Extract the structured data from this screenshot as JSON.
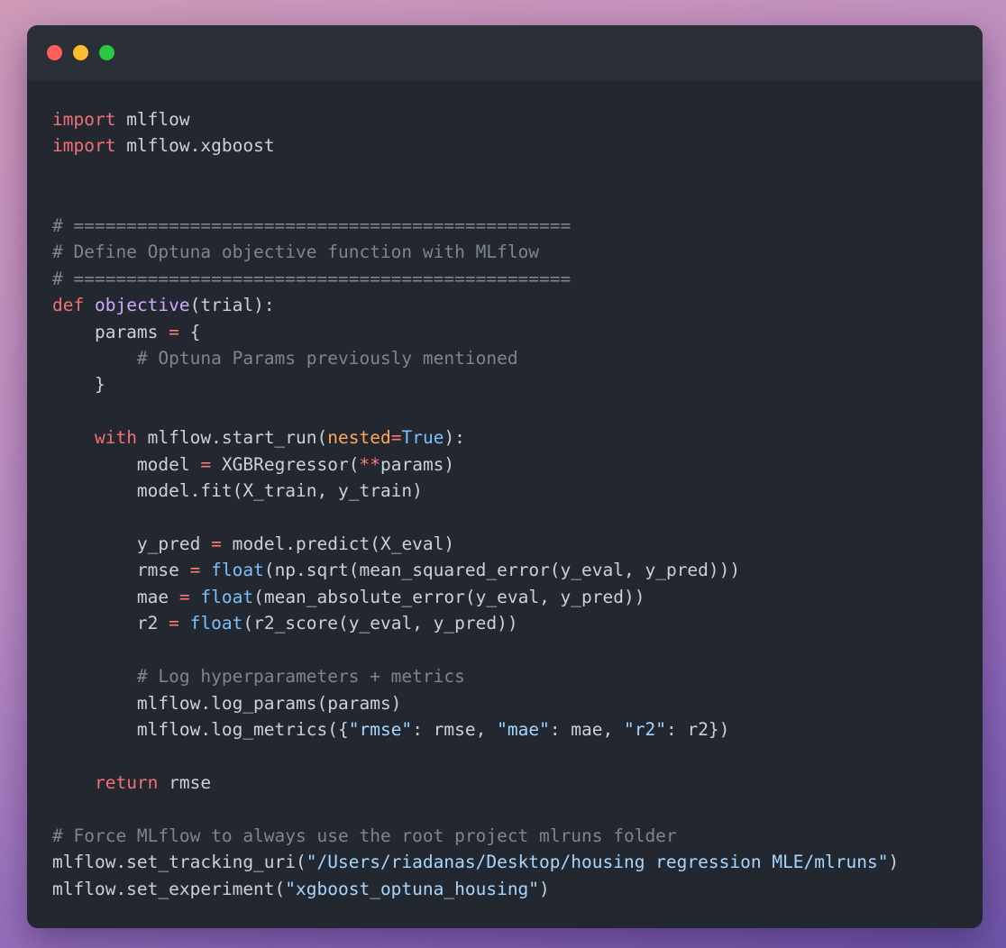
{
  "window": {
    "traffic_lights": [
      "close",
      "minimize",
      "maximize"
    ],
    "colors": {
      "close": "#ff5f57",
      "minimize": "#febc2e",
      "maximize": "#28c840",
      "background": "#23272f",
      "titlebar": "#2b2f37"
    }
  },
  "code": {
    "language": "python",
    "lines": [
      [
        {
          "t": "import",
          "c": "kw"
        },
        {
          "t": " mlflow",
          "c": "plain"
        }
      ],
      [
        {
          "t": "import",
          "c": "kw"
        },
        {
          "t": " mlflow.xgboost",
          "c": "plain"
        }
      ],
      [],
      [],
      [
        {
          "t": "# ===============================================",
          "c": "cm"
        }
      ],
      [
        {
          "t": "# Define Optuna objective function with MLflow",
          "c": "cm"
        }
      ],
      [
        {
          "t": "# ===============================================",
          "c": "cm"
        }
      ],
      [
        {
          "t": "def",
          "c": "kw"
        },
        {
          "t": " ",
          "c": "plain"
        },
        {
          "t": "objective",
          "c": "fn"
        },
        {
          "t": "(trial):",
          "c": "plain"
        }
      ],
      [
        {
          "t": "    params ",
          "c": "plain"
        },
        {
          "t": "=",
          "c": "op"
        },
        {
          "t": " {",
          "c": "plain"
        }
      ],
      [
        {
          "t": "        ",
          "c": "plain"
        },
        {
          "t": "# Optuna Params previously mentioned",
          "c": "cm"
        }
      ],
      [
        {
          "t": "    }",
          "c": "plain"
        }
      ],
      [],
      [
        {
          "t": "    ",
          "c": "plain"
        },
        {
          "t": "with",
          "c": "kw"
        },
        {
          "t": " mlflow.start_run(",
          "c": "plain"
        },
        {
          "t": "nested",
          "c": "arg"
        },
        {
          "t": "=",
          "c": "op"
        },
        {
          "t": "True",
          "c": "const"
        },
        {
          "t": "):",
          "c": "plain"
        }
      ],
      [
        {
          "t": "        model ",
          "c": "plain"
        },
        {
          "t": "=",
          "c": "op"
        },
        {
          "t": " XGBRegressor(",
          "c": "plain"
        },
        {
          "t": "**",
          "c": "op"
        },
        {
          "t": "params)",
          "c": "plain"
        }
      ],
      [
        {
          "t": "        model.fit(X_train, y_train)",
          "c": "plain"
        }
      ],
      [],
      [
        {
          "t": "        y_pred ",
          "c": "plain"
        },
        {
          "t": "=",
          "c": "op"
        },
        {
          "t": " model.predict(X_eval)",
          "c": "plain"
        }
      ],
      [
        {
          "t": "        rmse ",
          "c": "plain"
        },
        {
          "t": "=",
          "c": "op"
        },
        {
          "t": " ",
          "c": "plain"
        },
        {
          "t": "float",
          "c": "bi"
        },
        {
          "t": "(np.sqrt(mean_squared_error(y_eval, y_pred)))",
          "c": "plain"
        }
      ],
      [
        {
          "t": "        mae ",
          "c": "plain"
        },
        {
          "t": "=",
          "c": "op"
        },
        {
          "t": " ",
          "c": "plain"
        },
        {
          "t": "float",
          "c": "bi"
        },
        {
          "t": "(mean_absolute_error(y_eval, y_pred))",
          "c": "plain"
        }
      ],
      [
        {
          "t": "        r2 ",
          "c": "plain"
        },
        {
          "t": "=",
          "c": "op"
        },
        {
          "t": " ",
          "c": "plain"
        },
        {
          "t": "float",
          "c": "bi"
        },
        {
          "t": "(r2_score(y_eval, y_pred))",
          "c": "plain"
        }
      ],
      [],
      [
        {
          "t": "        ",
          "c": "plain"
        },
        {
          "t": "# Log hyperparameters + metrics",
          "c": "cm"
        }
      ],
      [
        {
          "t": "        mlflow.log_params(params)",
          "c": "plain"
        }
      ],
      [
        {
          "t": "        mlflow.log_metrics({",
          "c": "plain"
        },
        {
          "t": "\"rmse\"",
          "c": "str"
        },
        {
          "t": ": rmse, ",
          "c": "plain"
        },
        {
          "t": "\"mae\"",
          "c": "str"
        },
        {
          "t": ": mae, ",
          "c": "plain"
        },
        {
          "t": "\"r2\"",
          "c": "str"
        },
        {
          "t": ": r2})",
          "c": "plain"
        }
      ],
      [],
      [
        {
          "t": "    ",
          "c": "plain"
        },
        {
          "t": "return",
          "c": "kw"
        },
        {
          "t": " rmse",
          "c": "plain"
        }
      ],
      [],
      [
        {
          "t": "# Force MLflow to always use the root project mlruns folder",
          "c": "cm"
        }
      ],
      [
        {
          "t": "mlflow.set_tracking_uri(",
          "c": "plain"
        },
        {
          "t": "\"/Users/riadanas/Desktop/housing regression MLE/mlruns\"",
          "c": "str"
        },
        {
          "t": ")",
          "c": "plain"
        }
      ],
      [
        {
          "t": "mlflow.set_experiment(",
          "c": "plain"
        },
        {
          "t": "\"xgboost_optuna_housing\"",
          "c": "str"
        },
        {
          "t": ")",
          "c": "plain"
        }
      ]
    ]
  }
}
